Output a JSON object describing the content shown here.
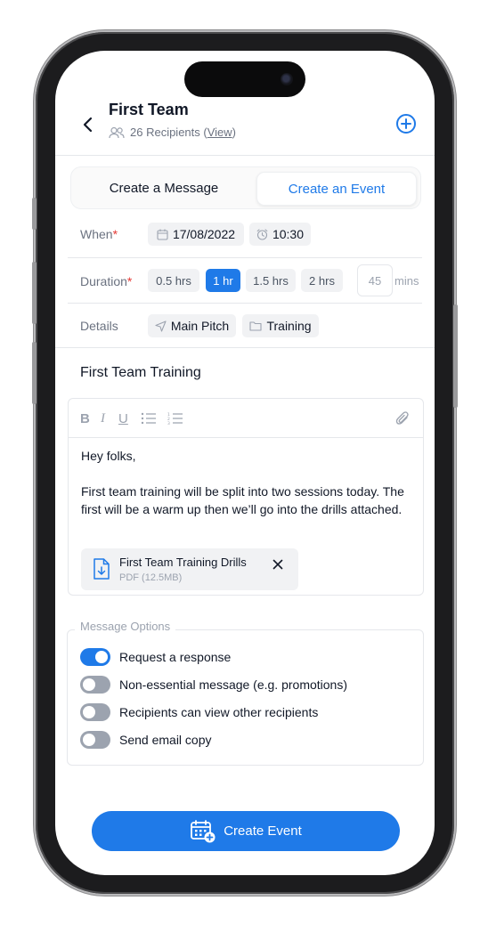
{
  "header": {
    "title": "First Team",
    "recipients_text": "26 Recipients (",
    "view_link": "View",
    "recipients_close": ")"
  },
  "tabs": [
    {
      "label": "Create a Message",
      "active": false
    },
    {
      "label": "Create an Event",
      "active": true
    }
  ],
  "when": {
    "label": "When",
    "required_mark": "*",
    "date": "17/08/2022",
    "time": "10:30"
  },
  "duration": {
    "label": "Duration",
    "required_mark": "*",
    "options": [
      "0.5 hrs",
      "1 hr",
      "1.5 hrs",
      "2 hrs"
    ],
    "selected": "1 hr",
    "custom_minutes_placeholder": "45",
    "minutes_label": "mins"
  },
  "details": {
    "label": "Details",
    "location": "Main Pitch",
    "category": "Training"
  },
  "event_title": "First Team Training",
  "editor": {
    "toolbar": [
      "bold-icon",
      "italic-icon",
      "underline-icon",
      "bullet-list-icon",
      "numbered-list-icon",
      "attachment-icon"
    ],
    "bold_glyph": "B",
    "italic_glyph": "I",
    "underline_glyph": "U",
    "paragraph_1": "Hey folks,",
    "paragraph_2": "First team training will be split into two sessions today. The first will be a warm up then we’ll go into the drills attached.",
    "attachment": {
      "name": "First Team Training Drills",
      "meta": "PDF (12.5MB)"
    }
  },
  "message_options": {
    "legend": "Message Options",
    "items": [
      {
        "label": "Request a response",
        "on": true
      },
      {
        "label": "Non-essential message (e.g. promotions)",
        "on": false
      },
      {
        "label": "Recipients can view other recipients",
        "on": false
      },
      {
        "label": "Send email copy",
        "on": false
      }
    ]
  },
  "primary_action": {
    "label": "Create Event",
    "icon": "calendar-add-icon"
  },
  "colors": {
    "accent": "#1f7ae8",
    "required": "#e53935",
    "muted": "#6b7280"
  }
}
